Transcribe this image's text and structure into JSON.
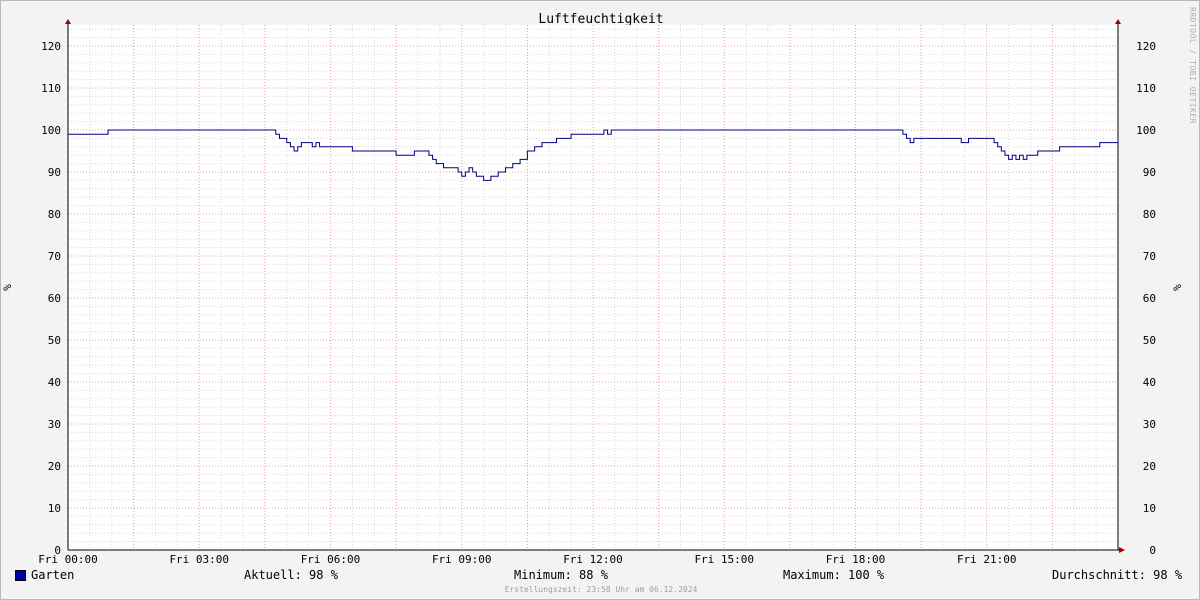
{
  "chart_data": {
    "type": "line",
    "title": "Luftfeuchtigkeit",
    "ylabel": "%",
    "ylim": [
      0,
      125
    ],
    "yticks": [
      0,
      10,
      20,
      30,
      40,
      50,
      60,
      70,
      80,
      90,
      100,
      110,
      120
    ],
    "xlim": [
      "Fri 00:00",
      "Sat 00:00"
    ],
    "xticks": [
      "Fri 00:00",
      "Fri 03:00",
      "Fri 06:00",
      "Fri 09:00",
      "Fri 12:00",
      "Fri 15:00",
      "Fri 18:00",
      "Fri 21:00"
    ],
    "grid": true,
    "series": [
      {
        "name": "Garten",
        "color": "#000080",
        "x": [
          "00:00",
          "00:55",
          "04:35",
          "04:45",
          "04:50",
          "05:00",
          "05:05",
          "05:10",
          "05:15",
          "05:20",
          "05:30",
          "05:35",
          "05:40",
          "05:45",
          "05:55",
          "06:00",
          "06:30",
          "06:45",
          "07:30",
          "07:50",
          "07:55",
          "08:15",
          "08:20",
          "08:25",
          "08:35",
          "08:50",
          "08:55",
          "09:00",
          "09:05",
          "09:10",
          "09:15",
          "09:20",
          "09:30",
          "09:40",
          "09:50",
          "10:00",
          "10:10",
          "10:20",
          "10:30",
          "10:40",
          "10:50",
          "11:10",
          "11:30",
          "12:15",
          "12:20",
          "12:25",
          "13:30",
          "16:30",
          "19:00",
          "19:05",
          "19:10",
          "19:15",
          "19:20",
          "20:00",
          "20:25",
          "20:35",
          "21:10",
          "21:15",
          "21:20",
          "21:25",
          "21:30",
          "21:35",
          "21:40",
          "21:45",
          "21:50",
          "21:55",
          "22:00",
          "22:10",
          "22:20",
          "22:40",
          "23:00",
          "23:35",
          "24:00"
        ],
        "values": [
          99,
          100,
          100,
          99,
          98,
          97,
          96,
          95,
          96,
          97,
          97,
          96,
          97,
          96,
          96,
          96,
          95,
          95,
          94,
          94,
          95,
          94,
          93,
          92,
          91,
          91,
          90,
          89,
          90,
          91,
          90,
          89,
          88,
          89,
          90,
          91,
          92,
          93,
          95,
          96,
          97,
          98,
          99,
          100,
          99,
          100,
          100,
          100,
          100,
          99,
          98,
          97,
          98,
          98,
          97,
          98,
          97,
          96,
          95,
          94,
          93,
          94,
          93,
          94,
          93,
          94,
          94,
          95,
          95,
          96,
          96,
          97,
          98
        ]
      }
    ],
    "legend": {
      "series_name": "Garten",
      "current_label": "Aktuell:",
      "current_value": "98 %",
      "min_label": "Minimum:",
      "min_value": "88 %",
      "max_label": "Maximum:",
      "max_value": "100 %",
      "avg_label": "Durchschnitt:",
      "avg_value": "98 %"
    },
    "footer": "Erstellungszeit: 23:58 Uhr am 06.12.2024",
    "watermark": "RRDTOOL / TOBI OETIKER"
  }
}
